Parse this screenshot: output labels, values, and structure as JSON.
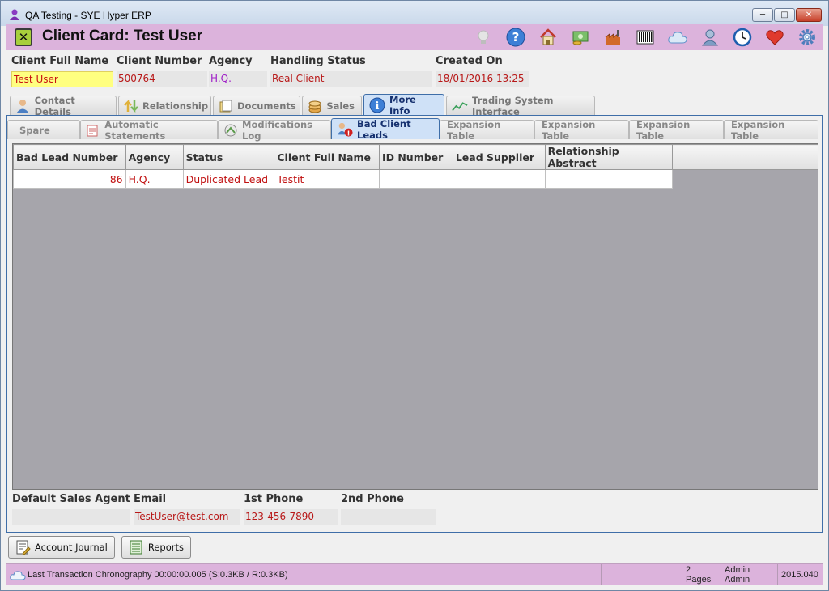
{
  "window": {
    "title": "QA Testing - SYE Hyper ERP"
  },
  "header": {
    "title": "Client Card: Test User",
    "toolbar_icons": [
      "lightbulb-icon",
      "help-icon",
      "home-icon",
      "money-icon",
      "factory-icon",
      "barcode-icon",
      "cloud-icon",
      "user-icon",
      "clock-icon",
      "heart-icon",
      "gear-icon"
    ]
  },
  "fields": {
    "client_full_name": {
      "label": "Client Full Name",
      "value": "Test User"
    },
    "client_number": {
      "label": "Client Number",
      "value": "500764"
    },
    "agency": {
      "label": "Agency",
      "value": "H.Q."
    },
    "handling_status": {
      "label": "Handling Status",
      "value": "Real Client"
    },
    "created_on": {
      "label": "Created On",
      "value": "18/01/2016 13:25"
    }
  },
  "tabs": [
    {
      "label": "Contact Details",
      "icon": "contact-icon"
    },
    {
      "label": "Relationship",
      "icon": "relationship-icon"
    },
    {
      "label": "Documents",
      "icon": "documents-icon"
    },
    {
      "label": "Sales",
      "icon": "sales-icon"
    },
    {
      "label": "More Info",
      "icon": "info-icon",
      "active": true
    },
    {
      "label": "Trading System Interface",
      "icon": "chart-line-icon"
    }
  ],
  "subtabs": [
    {
      "label": "Spare"
    },
    {
      "label": "Automatic Statements"
    },
    {
      "label": "Modifications Log"
    },
    {
      "label": "Bad Client Leads",
      "active": true
    },
    {
      "label": "Expansion Table"
    },
    {
      "label": "Expansion Table"
    },
    {
      "label": "Expansion Table"
    },
    {
      "label": "Expansion Table"
    }
  ],
  "table": {
    "columns": [
      "Bad Lead Number",
      "Agency",
      "Status",
      "Client Full Name",
      "ID Number",
      "Lead Supplier",
      "Relationship Abstract"
    ],
    "rows": [
      [
        "86",
        "H.Q.",
        "Duplicated Lead",
        "Testit",
        "",
        "",
        ""
      ]
    ]
  },
  "bottom_fields": {
    "default_sales_agent": {
      "label": "Default Sales Agent",
      "value": ""
    },
    "email": {
      "label": "Email",
      "value": "TestUser@test.com"
    },
    "phone1": {
      "label": "1st Phone",
      "value": "123-456-7890"
    },
    "phone2": {
      "label": "2nd Phone",
      "value": ""
    }
  },
  "buttons": {
    "account_journal": "Account Journal",
    "reports": "Reports"
  },
  "status": {
    "transaction": "Last Transaction Chronography  00:00:00.005  (S:0.3KB / R:0.3KB)",
    "pages": "2 Pages",
    "user": "Admin Admin",
    "version": "2015.040"
  },
  "colors": {
    "header_bg": "#dcb3dc",
    "accent": "#3f6ea8",
    "value_text": "#c01010"
  }
}
